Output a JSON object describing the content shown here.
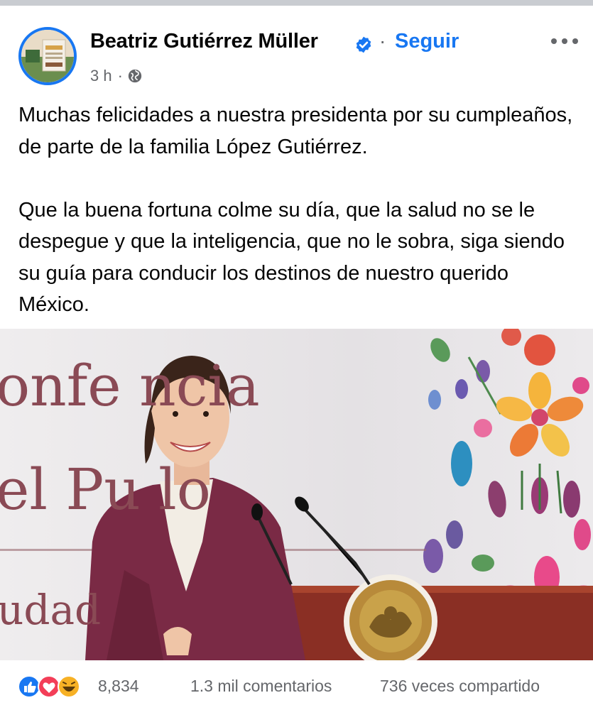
{
  "post": {
    "author": "Beatriz Gutiérrez Müller",
    "follow_label": "Seguir",
    "separator": "·",
    "time": "3 h",
    "audience_icon": "globe-icon",
    "verified_icon": "verified-badge-icon",
    "more_icon": "more-options-icon",
    "avatar_text": "LOS 318",
    "paragraphs": [
      "Muchas felicidades a nuestra presidenta por su cumpleaños, de parte de la familia López Gutiérrez.",
      "Que la buena fortuna colme su día, que la salud no se le despegue y que la inteligencia, que no le sobra, siga siendo su guía para conducir los destinos de nuestro querido México."
    ]
  },
  "photo": {
    "banner_line1": "onfe  ncia",
    "banner_line2": "el Pu   lo",
    "banner_line3": "udad",
    "seal_text": "ESTADOS UNIDOS MEXICANOS"
  },
  "footer": {
    "reaction_icons": [
      "like-icon",
      "love-icon",
      "haha-icon"
    ],
    "reaction_count": "8,834",
    "comments": "1.3 mil comentarios",
    "shares": "736 veces compartido"
  },
  "colors": {
    "accent": "#1877f2",
    "text": "#050505",
    "secondary": "#65676b",
    "jacket": "#7a2a45"
  }
}
